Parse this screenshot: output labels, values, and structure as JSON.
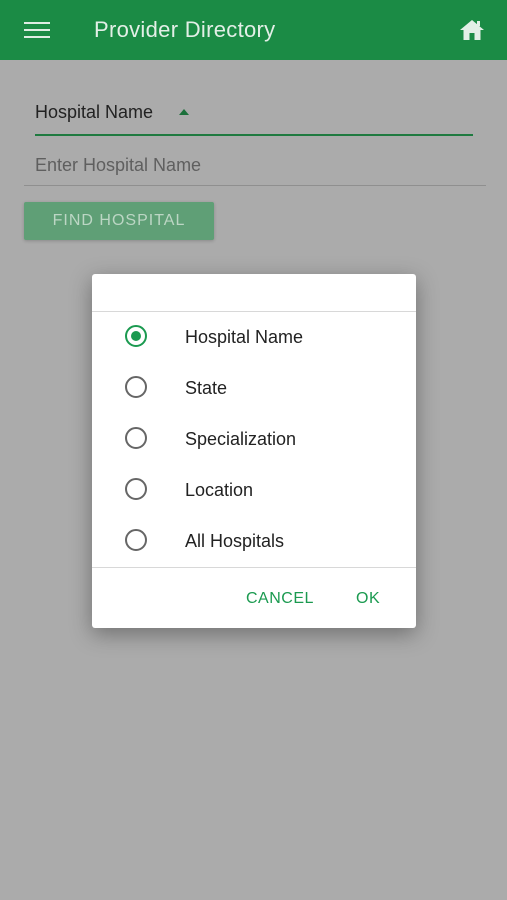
{
  "appbar": {
    "title": "Provider Directory",
    "menu_icon": "hamburger-menu-icon",
    "home_icon": "home-icon",
    "color": "#1b8b45"
  },
  "search": {
    "mode_label": "Hospital Name",
    "input_placeholder": "Enter Hospital Name",
    "input_value": "",
    "find_button": "FIND HOSPITAL"
  },
  "dialog": {
    "options": [
      {
        "label": "Hospital Name",
        "selected": true
      },
      {
        "label": "State",
        "selected": false
      },
      {
        "label": "Specialization",
        "selected": false
      },
      {
        "label": "Location",
        "selected": false
      },
      {
        "label": "All Hospitals",
        "selected": false
      }
    ],
    "cancel_label": "CANCEL",
    "ok_label": "OK",
    "accent": "#1b9a50"
  }
}
